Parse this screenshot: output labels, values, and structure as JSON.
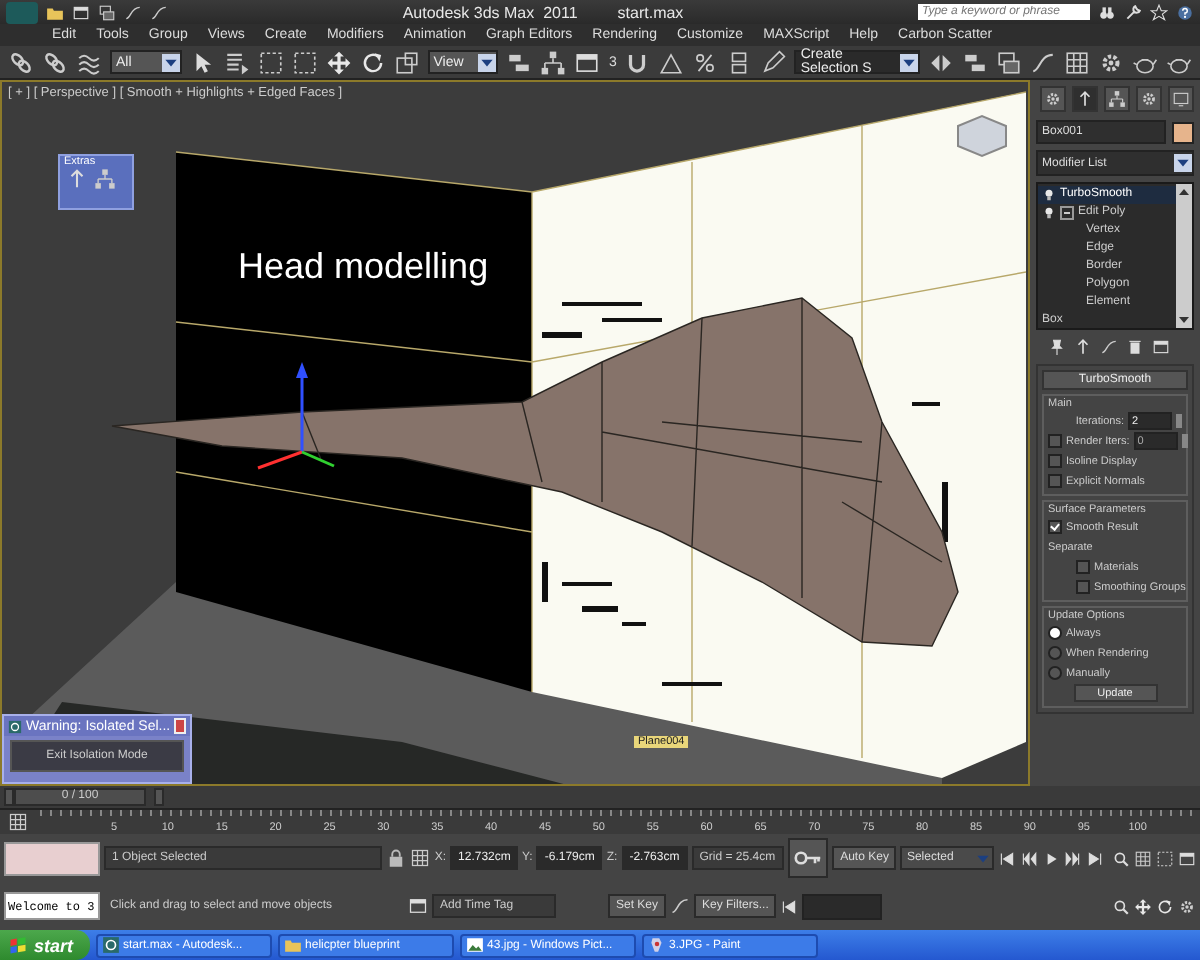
{
  "title_bar": {
    "app_title": "Autodesk 3ds Max  2011",
    "file_name": "start.max",
    "search_placeholder": "Type a keyword or phrase"
  },
  "menu": [
    "Edit",
    "Tools",
    "Group",
    "Views",
    "Create",
    "Modifiers",
    "Animation",
    "Graph Editors",
    "Rendering",
    "Customize",
    "MAXScript",
    "Help",
    "Carbon Scatter"
  ],
  "toolbar": {
    "selection_filter": "All",
    "reference_coordinate": "View",
    "snap_label": "3",
    "named_selection": "Create Selection S"
  },
  "viewport": {
    "label": "[ + ] [ Perspective ] [ Smooth + Highlights + Edged Faces ]",
    "annotation": "Head modelling",
    "object_tag": "Plane004",
    "extras_title": "Extras"
  },
  "isolation_dialog": {
    "title": "Warning: Isolated Sel...",
    "button": "Exit Isolation Mode"
  },
  "command_panel": {
    "object_name": "Box001",
    "modifier_list": "Modifier List",
    "stack": [
      {
        "label": "TurboSmooth",
        "selected": true
      },
      {
        "label": "Edit Poly",
        "selected": false,
        "expanded": true,
        "children": [
          {
            "label": "Vertex",
            "selected": false
          },
          {
            "label": "Edge",
            "selected": false
          },
          {
            "label": "Border",
            "selected": false
          },
          {
            "label": "Polygon",
            "selected": false
          },
          {
            "label": "Element",
            "selected": false
          }
        ]
      },
      {
        "label": "Box",
        "selected": false
      }
    ],
    "rollout": {
      "title": "TurboSmooth",
      "groups": [
        {
          "title": "Main",
          "rows": [
            {
              "kind": "spinner",
              "label": "Iterations:",
              "value": "2"
            },
            {
              "kind": "check_spinner",
              "label": "Render Iters:",
              "checked": false,
              "value": "0"
            },
            {
              "kind": "checkbox",
              "label": "Isoline Display",
              "checked": false
            },
            {
              "kind": "checkbox",
              "label": "Explicit Normals",
              "checked": false
            }
          ]
        },
        {
          "title": "Surface Parameters",
          "rows": [
            {
              "kind": "checkbox",
              "label": "Smooth Result",
              "checked": true
            },
            {
              "kind": "label",
              "label": "Separate"
            },
            {
              "kind": "sub_checkbox",
              "label": "Materials",
              "checked": false
            },
            {
              "kind": "sub_checkbox",
              "label": "Smoothing Groups",
              "checked": false
            }
          ]
        },
        {
          "title": "Update Options",
          "rows": [
            {
              "kind": "radio",
              "label": "Always",
              "selected": true
            },
            {
              "kind": "radio",
              "label": "When Rendering",
              "selected": false
            },
            {
              "kind": "radio",
              "label": "Manually",
              "selected": false
            },
            {
              "kind": "button",
              "label": "Update"
            }
          ]
        }
      ]
    }
  },
  "time_slider": {
    "position": "0 / 100",
    "level": 0,
    "ticks": [
      "5",
      "10",
      "15",
      "20",
      "25",
      "30",
      "35",
      "40",
      "45",
      "50",
      "55",
      "60",
      "65",
      "70",
      "75",
      "80",
      "85",
      "90",
      "95",
      "100"
    ]
  },
  "status_bar": {
    "listener_output": "Welcome to 3",
    "selection_info": "1 Object Selected",
    "prompt": "Click and drag to select and move objects",
    "coordinates": [
      {
        "axis": "X:",
        "value": "12.732cm"
      },
      {
        "axis": "Y:",
        "value": "-6.179cm"
      },
      {
        "axis": "Z:",
        "value": "-2.763cm"
      }
    ],
    "grid": "Grid = 25.4cm",
    "time_tag": "Add Time Tag",
    "auto_key": "Auto Key",
    "key_mode": "Selected",
    "set_key": "Set Key",
    "key_filters": "Key Filters..."
  },
  "taskbar": {
    "start": "start",
    "tasks": [
      {
        "kind": "max",
        "label": "start.max - Autodesk..."
      },
      {
        "kind": "folder",
        "label": "helicpter blueprint"
      },
      {
        "kind": "picture",
        "label": "43.jpg - Windows Pict..."
      },
      {
        "kind": "paint",
        "label": "3.JPG - Paint"
      }
    ]
  }
}
